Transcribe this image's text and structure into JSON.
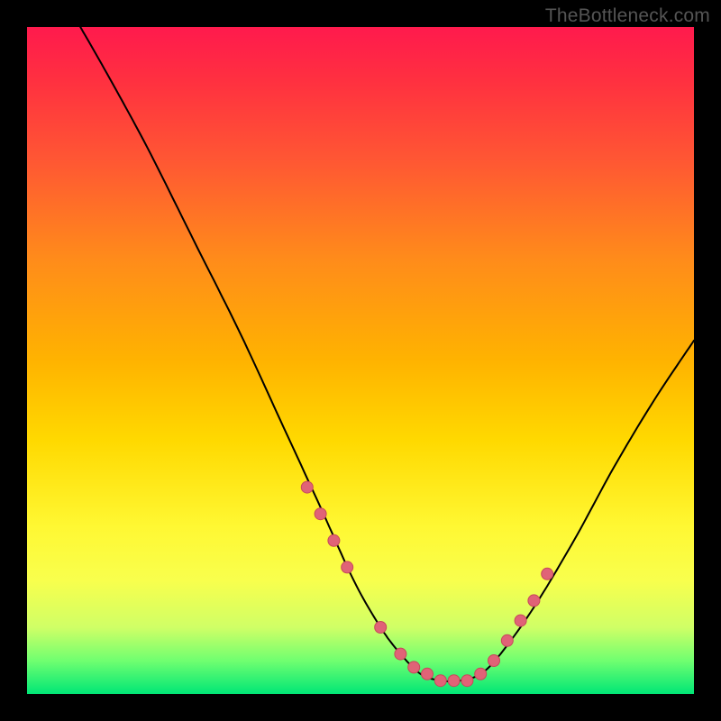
{
  "watermark": "TheBottleneck.com",
  "colors": {
    "curve_stroke": "#000000",
    "marker_fill": "#e06377",
    "marker_stroke": "#c7495a"
  },
  "chart_data": {
    "type": "line",
    "title": "",
    "xlabel": "",
    "ylabel": "",
    "xlim": [
      0,
      100
    ],
    "ylim": [
      0,
      100
    ],
    "grid": false,
    "legend": false,
    "annotations": [],
    "series": [
      {
        "name": "bottleneck-curve",
        "x": [
          8,
          12,
          18,
          25,
          32,
          38,
          44,
          49,
          53,
          56,
          59,
          62,
          65,
          68,
          71,
          76,
          82,
          88,
          94,
          100
        ],
        "y": [
          100,
          93,
          82,
          68,
          54,
          41,
          28,
          17,
          10,
          6,
          3,
          2,
          2,
          3,
          6,
          13,
          23,
          34,
          44,
          53
        ]
      }
    ],
    "markers": {
      "name": "highlight-points",
      "x": [
        42,
        44,
        46,
        48,
        53,
        56,
        58,
        60,
        62,
        64,
        66,
        68,
        70,
        72,
        74,
        76,
        78
      ],
      "y": [
        31,
        27,
        23,
        19,
        10,
        6,
        4,
        3,
        2,
        2,
        2,
        3,
        5,
        8,
        11,
        14,
        18
      ]
    }
  }
}
